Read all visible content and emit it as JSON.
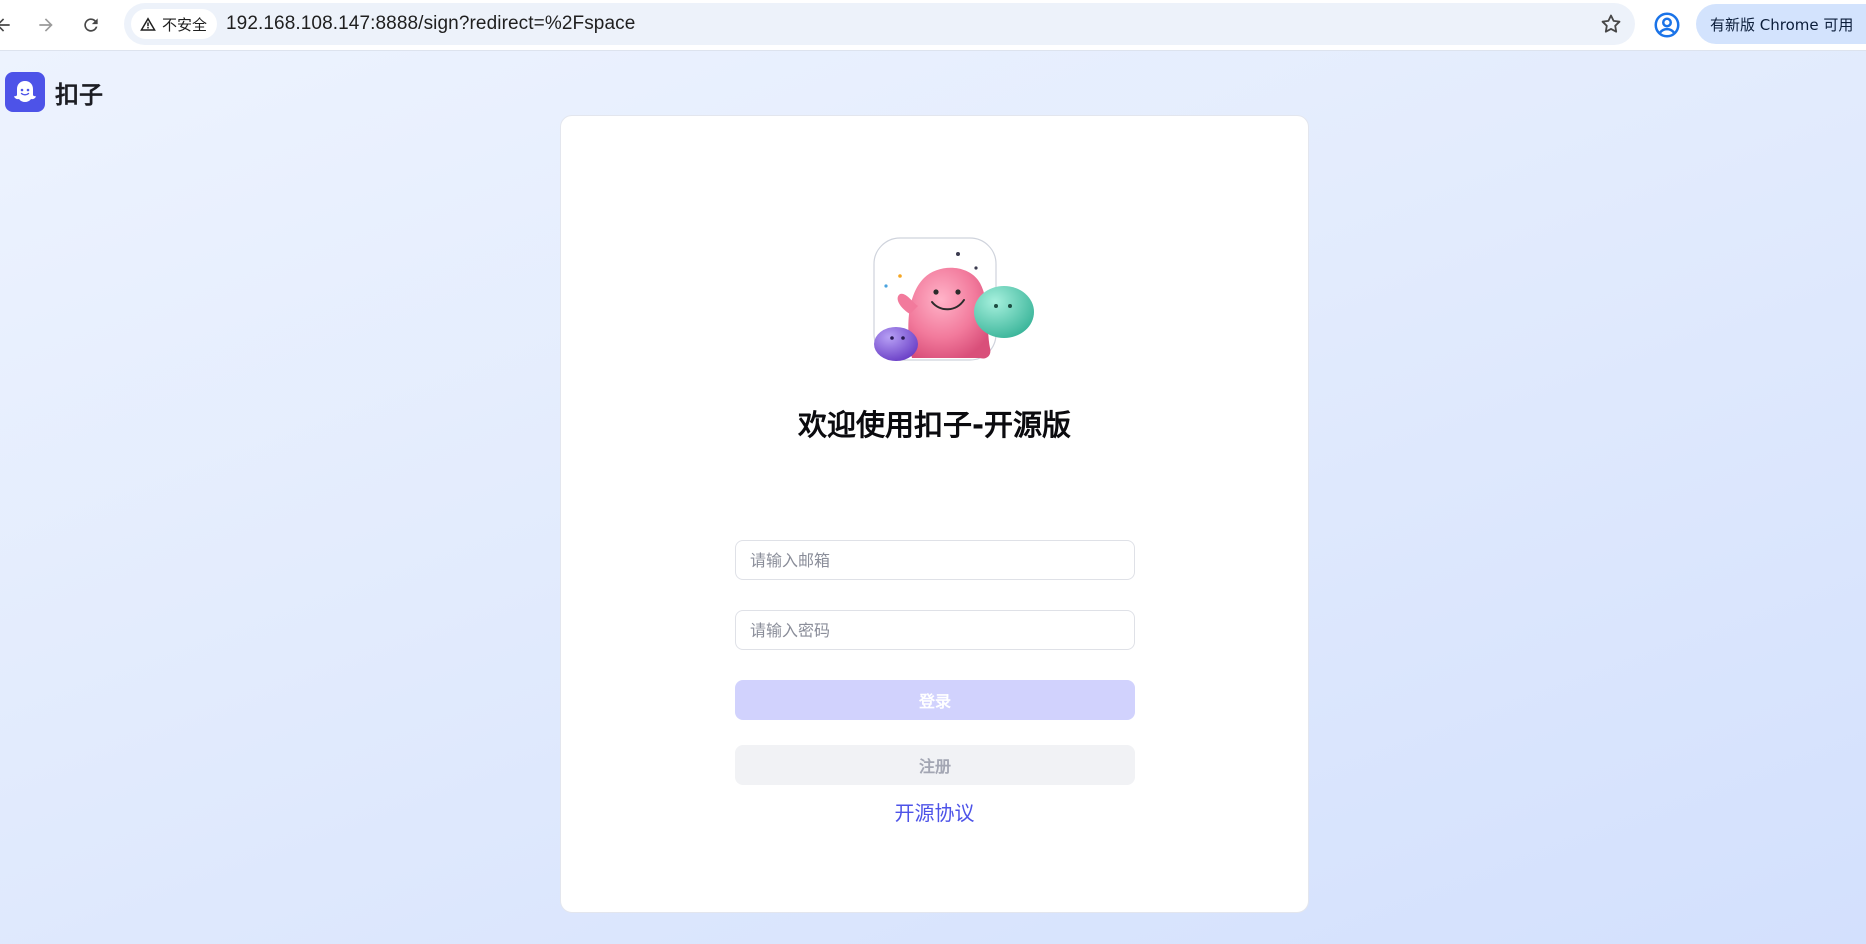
{
  "browser": {
    "security_label": "不安全",
    "url": "192.168.108.147:8888/sign?redirect=%2Fspace",
    "update_label": "有新版 Chrome 可用"
  },
  "brand": {
    "name": "扣子"
  },
  "login": {
    "welcome": "欢迎使用扣子-开源版",
    "email_placeholder": "请输入邮箱",
    "password_placeholder": "请输入密码",
    "login_label": "登录",
    "register_label": "注册",
    "license_label": "开源协议"
  },
  "colors": {
    "accent": "#4d53e8",
    "login_disabled": "#d1d2fd",
    "register_bg": "#f1f2f5"
  }
}
